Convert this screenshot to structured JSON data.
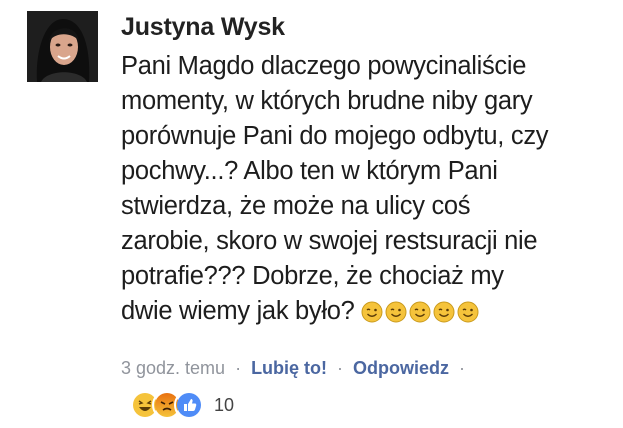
{
  "comment": {
    "author": "Justyna Wysk",
    "lines": [
      "Pani Magdo dlaczego powycinaliście",
      "momenty, w których brudne niby gary",
      "porównuje Pani do mojego odbytu, czy",
      "pochwy...? Albo ten w którym Pani",
      "stwierdza, że może na ulicy coś",
      "zarobie, skoro w swojej restsuracji nie",
      "potrafie??? Dobrze, że chociaż my",
      "dwie wiemy jak było?"
    ],
    "emojis": [
      "wink-emoji",
      "wink-emoji",
      "wink-emoji",
      "wink-emoji",
      "wink-emoji"
    ],
    "timestamp": "3 godz. temu",
    "like_label": "Lubię to!",
    "reply_label": "Odpowiedz",
    "reaction_count": "10",
    "reactions": [
      "haha-reaction-icon",
      "angry-reaction-icon",
      "like-reaction-icon"
    ],
    "colors": {
      "link": "#4b67a1",
      "meta": "#90949c",
      "emoji_yellow": "#f5c33b",
      "like_blue": "#4f8cf7",
      "angry_red": "#e9710f"
    }
  }
}
